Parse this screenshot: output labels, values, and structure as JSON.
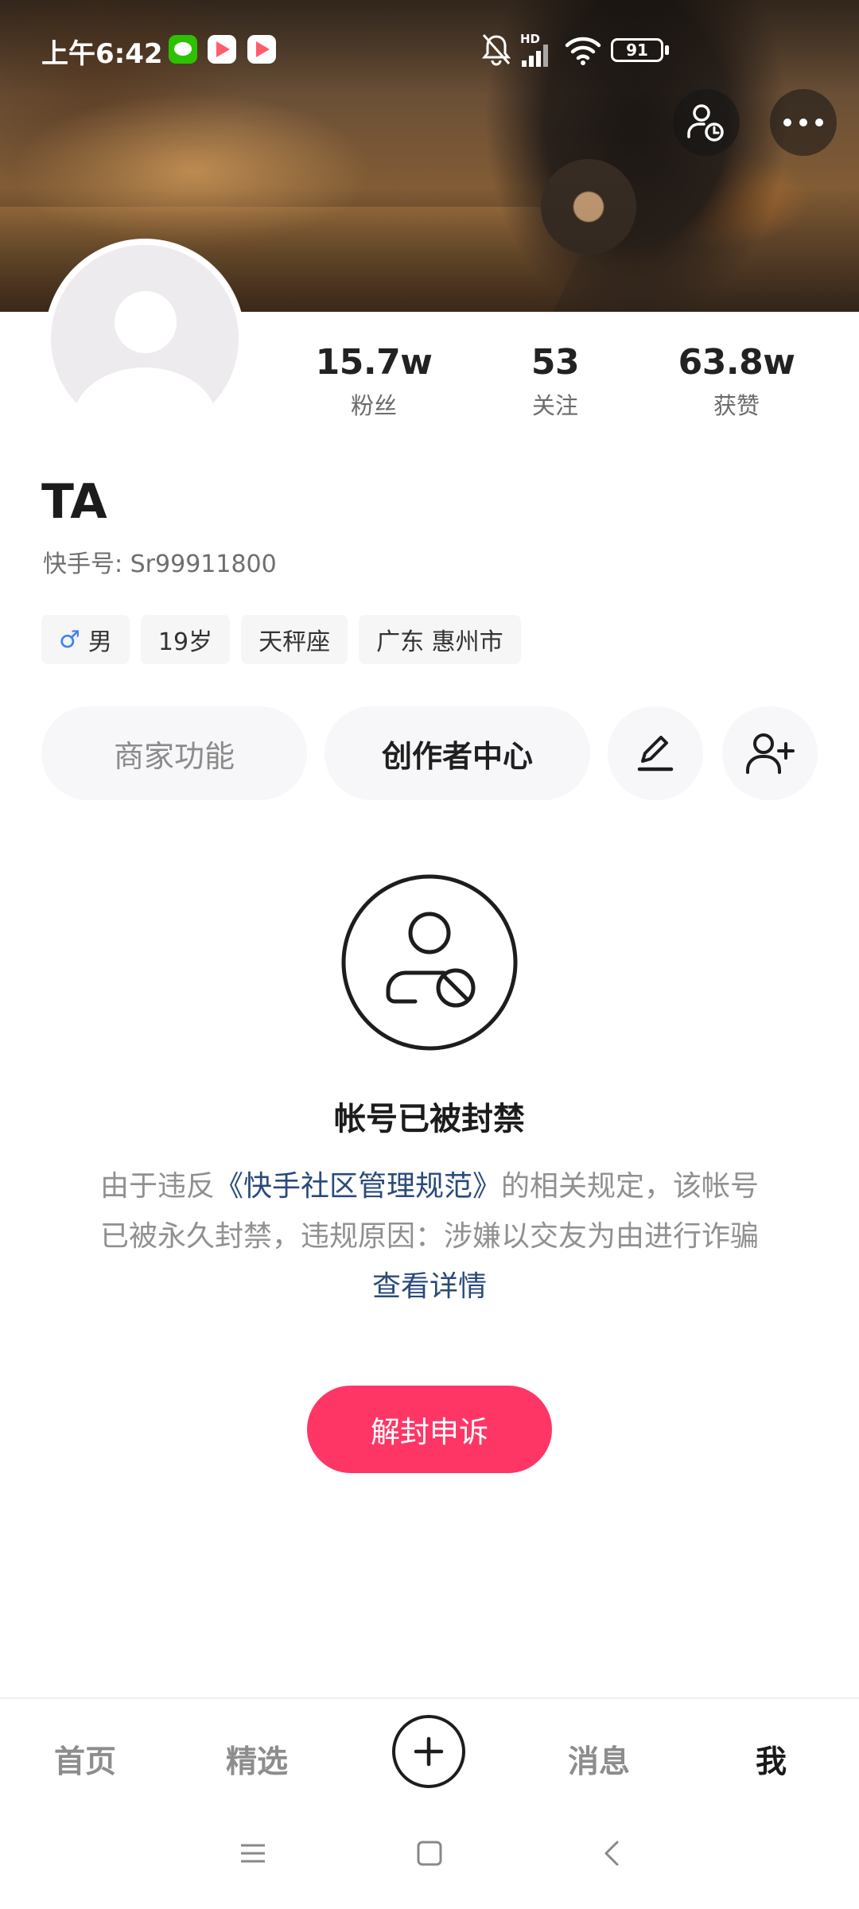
{
  "status_bar": {
    "time": "上午6:42",
    "battery": "91",
    "network": "HD",
    "notifications": [
      "wechat-icon",
      "kuaishou-icon",
      "kuaishou-icon"
    ],
    "system_icons": [
      "mute-bell-icon",
      "signal-icon",
      "wifi-icon",
      "battery-icon"
    ]
  },
  "header": {
    "buttons": [
      "visitor-icon",
      "more-icon"
    ]
  },
  "profile": {
    "stats": [
      {
        "value": "15.7w",
        "label": "粉丝"
      },
      {
        "value": "53",
        "label": "关注"
      },
      {
        "value": "63.8w",
        "label": "获赞"
      }
    ],
    "name": "TA",
    "kuaishou_id": "快手号: Sr99911800",
    "tags": {
      "gender_symbol": "♂",
      "gender": "男",
      "age": "19岁",
      "zodiac": "天秤座",
      "location": "广东 惠州市"
    }
  },
  "actions": {
    "merchant": "商家功能",
    "creator_center": "创作者中心",
    "edit_icon": "edit-icon",
    "add_friend_icon": "add-friend-icon"
  },
  "ban": {
    "title": "帐号已被封禁",
    "desc_prefix": "由于违反",
    "rules_link": "《快手社区管理规范》",
    "desc_middle": "的相关规定，该帐号已被永久封禁，违规原因：涉嫌以交友为由进行诈骗",
    "details_link": "查看详情",
    "appeal_button": "解封申诉"
  },
  "tab_bar": {
    "home": "首页",
    "featured": "精选",
    "messages": "消息",
    "me": "我"
  },
  "colors": {
    "accent": "#fe3666",
    "link": "#2a4a7a",
    "male": "#3b7ff5"
  }
}
